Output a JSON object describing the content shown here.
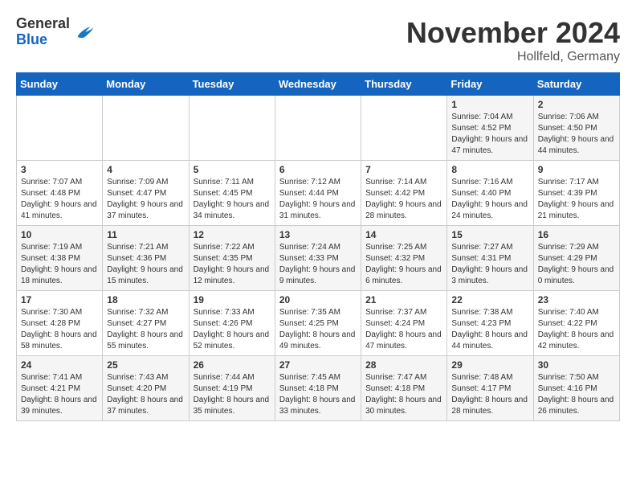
{
  "logo": {
    "general": "General",
    "blue": "Blue"
  },
  "header": {
    "title": "November 2024",
    "subtitle": "Hollfeld, Germany"
  },
  "weekdays": [
    "Sunday",
    "Monday",
    "Tuesday",
    "Wednesday",
    "Thursday",
    "Friday",
    "Saturday"
  ],
  "weeks": [
    [
      {
        "day": "",
        "info": ""
      },
      {
        "day": "",
        "info": ""
      },
      {
        "day": "",
        "info": ""
      },
      {
        "day": "",
        "info": ""
      },
      {
        "day": "",
        "info": ""
      },
      {
        "day": "1",
        "info": "Sunrise: 7:04 AM\nSunset: 4:52 PM\nDaylight: 9 hours and 47 minutes."
      },
      {
        "day": "2",
        "info": "Sunrise: 7:06 AM\nSunset: 4:50 PM\nDaylight: 9 hours and 44 minutes."
      }
    ],
    [
      {
        "day": "3",
        "info": "Sunrise: 7:07 AM\nSunset: 4:48 PM\nDaylight: 9 hours and 41 minutes."
      },
      {
        "day": "4",
        "info": "Sunrise: 7:09 AM\nSunset: 4:47 PM\nDaylight: 9 hours and 37 minutes."
      },
      {
        "day": "5",
        "info": "Sunrise: 7:11 AM\nSunset: 4:45 PM\nDaylight: 9 hours and 34 minutes."
      },
      {
        "day": "6",
        "info": "Sunrise: 7:12 AM\nSunset: 4:44 PM\nDaylight: 9 hours and 31 minutes."
      },
      {
        "day": "7",
        "info": "Sunrise: 7:14 AM\nSunset: 4:42 PM\nDaylight: 9 hours and 28 minutes."
      },
      {
        "day": "8",
        "info": "Sunrise: 7:16 AM\nSunset: 4:40 PM\nDaylight: 9 hours and 24 minutes."
      },
      {
        "day": "9",
        "info": "Sunrise: 7:17 AM\nSunset: 4:39 PM\nDaylight: 9 hours and 21 minutes."
      }
    ],
    [
      {
        "day": "10",
        "info": "Sunrise: 7:19 AM\nSunset: 4:38 PM\nDaylight: 9 hours and 18 minutes."
      },
      {
        "day": "11",
        "info": "Sunrise: 7:21 AM\nSunset: 4:36 PM\nDaylight: 9 hours and 15 minutes."
      },
      {
        "day": "12",
        "info": "Sunrise: 7:22 AM\nSunset: 4:35 PM\nDaylight: 9 hours and 12 minutes."
      },
      {
        "day": "13",
        "info": "Sunrise: 7:24 AM\nSunset: 4:33 PM\nDaylight: 9 hours and 9 minutes."
      },
      {
        "day": "14",
        "info": "Sunrise: 7:25 AM\nSunset: 4:32 PM\nDaylight: 9 hours and 6 minutes."
      },
      {
        "day": "15",
        "info": "Sunrise: 7:27 AM\nSunset: 4:31 PM\nDaylight: 9 hours and 3 minutes."
      },
      {
        "day": "16",
        "info": "Sunrise: 7:29 AM\nSunset: 4:29 PM\nDaylight: 9 hours and 0 minutes."
      }
    ],
    [
      {
        "day": "17",
        "info": "Sunrise: 7:30 AM\nSunset: 4:28 PM\nDaylight: 8 hours and 58 minutes."
      },
      {
        "day": "18",
        "info": "Sunrise: 7:32 AM\nSunset: 4:27 PM\nDaylight: 8 hours and 55 minutes."
      },
      {
        "day": "19",
        "info": "Sunrise: 7:33 AM\nSunset: 4:26 PM\nDaylight: 8 hours and 52 minutes."
      },
      {
        "day": "20",
        "info": "Sunrise: 7:35 AM\nSunset: 4:25 PM\nDaylight: 8 hours and 49 minutes."
      },
      {
        "day": "21",
        "info": "Sunrise: 7:37 AM\nSunset: 4:24 PM\nDaylight: 8 hours and 47 minutes."
      },
      {
        "day": "22",
        "info": "Sunrise: 7:38 AM\nSunset: 4:23 PM\nDaylight: 8 hours and 44 minutes."
      },
      {
        "day": "23",
        "info": "Sunrise: 7:40 AM\nSunset: 4:22 PM\nDaylight: 8 hours and 42 minutes."
      }
    ],
    [
      {
        "day": "24",
        "info": "Sunrise: 7:41 AM\nSunset: 4:21 PM\nDaylight: 8 hours and 39 minutes."
      },
      {
        "day": "25",
        "info": "Sunrise: 7:43 AM\nSunset: 4:20 PM\nDaylight: 8 hours and 37 minutes."
      },
      {
        "day": "26",
        "info": "Sunrise: 7:44 AM\nSunset: 4:19 PM\nDaylight: 8 hours and 35 minutes."
      },
      {
        "day": "27",
        "info": "Sunrise: 7:45 AM\nSunset: 4:18 PM\nDaylight: 8 hours and 33 minutes."
      },
      {
        "day": "28",
        "info": "Sunrise: 7:47 AM\nSunset: 4:18 PM\nDaylight: 8 hours and 30 minutes."
      },
      {
        "day": "29",
        "info": "Sunrise: 7:48 AM\nSunset: 4:17 PM\nDaylight: 8 hours and 28 minutes."
      },
      {
        "day": "30",
        "info": "Sunrise: 7:50 AM\nSunset: 4:16 PM\nDaylight: 8 hours and 26 minutes."
      }
    ]
  ]
}
